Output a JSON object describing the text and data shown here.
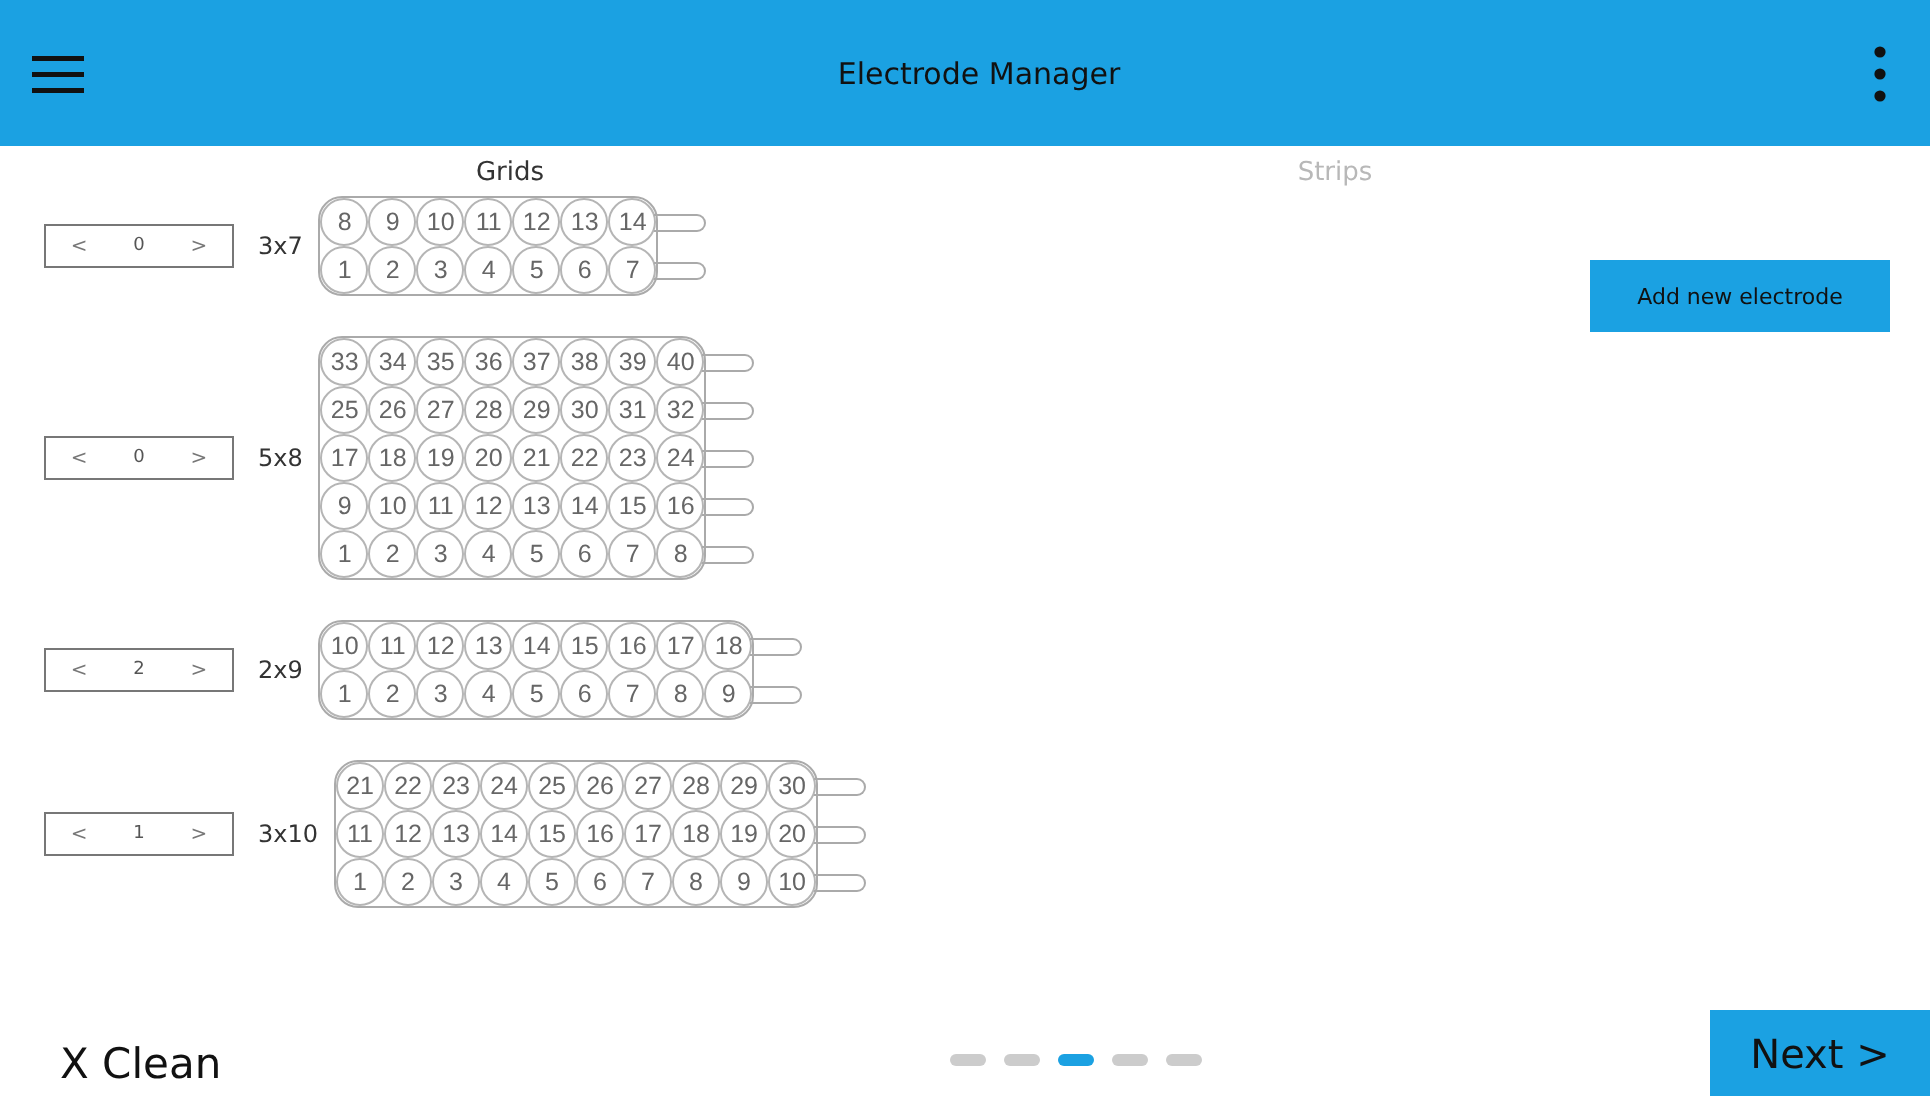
{
  "header": {
    "title": "Electrode Manager"
  },
  "tabs": [
    {
      "label": "Grids",
      "selected": true
    },
    {
      "label": "Strips",
      "selected": false
    }
  ],
  "grids": [
    {
      "dec": "<",
      "value": "0",
      "inc": ">",
      "label": "3x7",
      "rows": [
        [
          "8",
          "9",
          "10",
          "11",
          "12",
          "13",
          "14"
        ],
        [
          "1",
          "2",
          "3",
          "4",
          "5",
          "6",
          "7"
        ]
      ]
    },
    {
      "dec": "<",
      "value": "0",
      "inc": ">",
      "label": "5x8",
      "rows": [
        [
          "33",
          "34",
          "35",
          "36",
          "37",
          "38",
          "39",
          "40"
        ],
        [
          "25",
          "26",
          "27",
          "28",
          "29",
          "30",
          "31",
          "32"
        ],
        [
          "17",
          "18",
          "19",
          "20",
          "21",
          "22",
          "23",
          "24"
        ],
        [
          "9",
          "10",
          "11",
          "12",
          "13",
          "14",
          "15",
          "16"
        ],
        [
          "1",
          "2",
          "3",
          "4",
          "5",
          "6",
          "7",
          "8"
        ]
      ]
    },
    {
      "dec": "<",
      "value": "2",
      "inc": ">",
      "label": "2x9",
      "rows": [
        [
          "10",
          "11",
          "12",
          "13",
          "14",
          "15",
          "16",
          "17",
          "18"
        ],
        [
          "1",
          "2",
          "3",
          "4",
          "5",
          "6",
          "7",
          "8",
          "9"
        ]
      ]
    },
    {
      "dec": "<",
      "value": "1",
      "inc": ">",
      "label": "3x10",
      "rows": [
        [
          "21",
          "22",
          "23",
          "24",
          "25",
          "26",
          "27",
          "28",
          "29",
          "30"
        ],
        [
          "11",
          "12",
          "13",
          "14",
          "15",
          "16",
          "17",
          "18",
          "19",
          "20"
        ],
        [
          "1",
          "2",
          "3",
          "4",
          "5",
          "6",
          "7",
          "8",
          "9",
          "10"
        ]
      ]
    }
  ],
  "add_button": "Add new electrode",
  "footer": {
    "clean": "X Clean",
    "next": "Next >",
    "pages": [
      {
        "selected": false
      },
      {
        "selected": false
      },
      {
        "selected": true
      },
      {
        "selected": false
      },
      {
        "selected": false
      }
    ]
  }
}
